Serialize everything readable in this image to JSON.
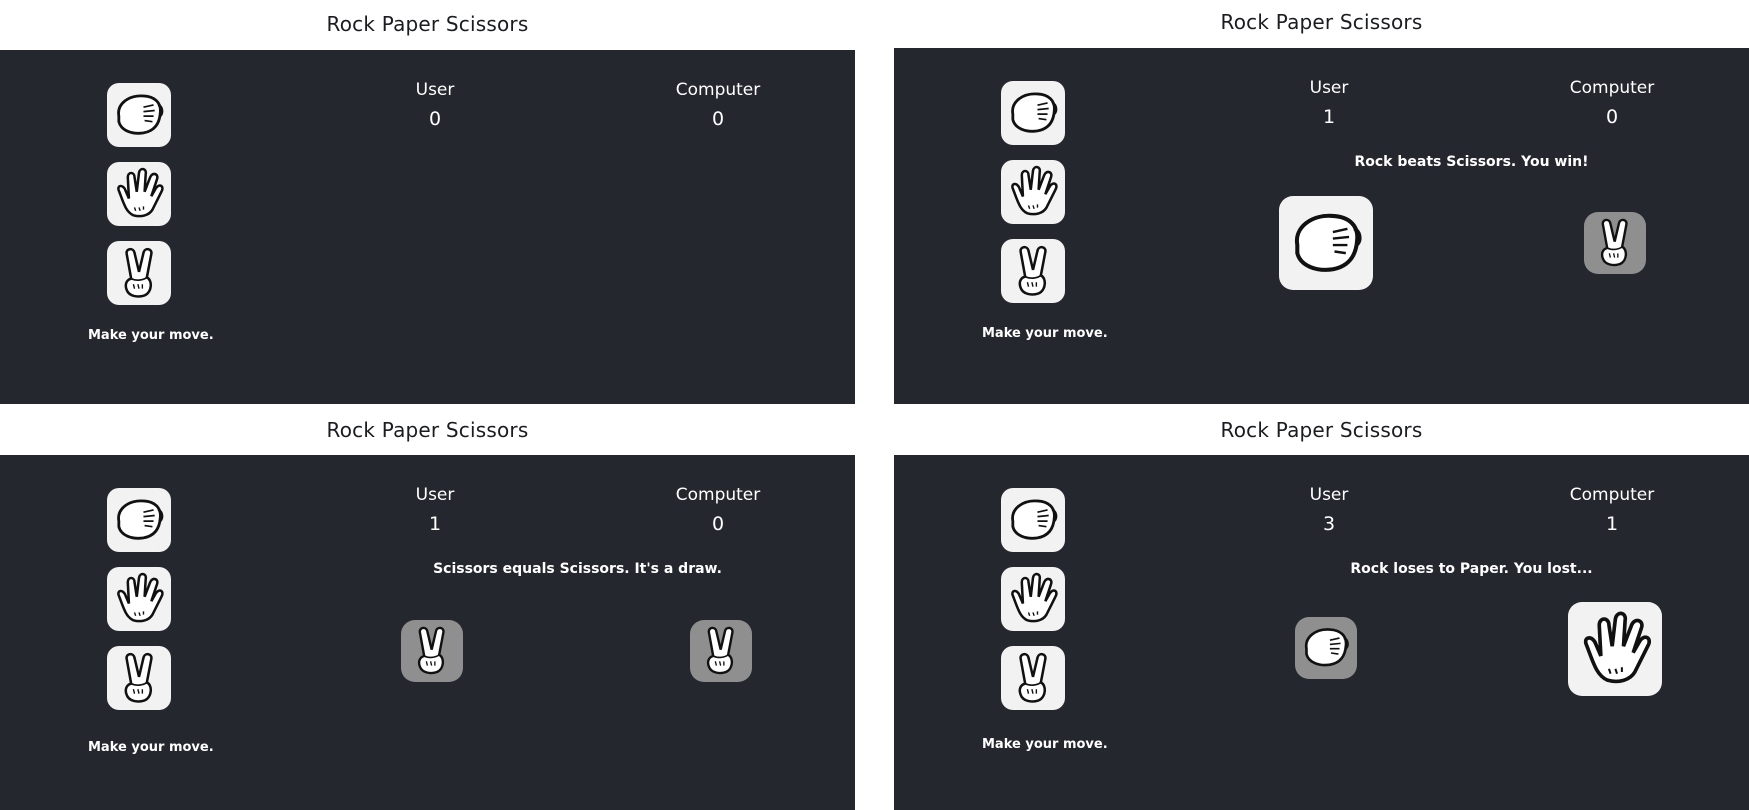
{
  "panels": [
    {
      "title": "Rock Paper Scissors",
      "score_labels": {
        "user": "User",
        "computer": "Computer"
      },
      "scores": {
        "user": "0",
        "computer": "0"
      },
      "result": "",
      "prompt": "Make your move.",
      "choices": [
        "rock-icon",
        "paper-icon",
        "scissors-icon"
      ]
    },
    {
      "title": "Rock Paper Scissors",
      "score_labels": {
        "user": "User",
        "computer": "Computer"
      },
      "scores": {
        "user": "1",
        "computer": "0"
      },
      "result": "Rock beats Scissors. You win!",
      "prompt": "Make your move.",
      "user_pick": "rock-icon",
      "computer_pick": "scissors-icon"
    },
    {
      "title": "Rock Paper Scissors",
      "score_labels": {
        "user": "User",
        "computer": "Computer"
      },
      "scores": {
        "user": "1",
        "computer": "0"
      },
      "result": "Scissors equals Scissors. It's a draw.",
      "prompt": "Make your move.",
      "user_pick": "scissors-icon",
      "computer_pick": "scissors-icon"
    },
    {
      "title": "Rock Paper Scissors",
      "score_labels": {
        "user": "User",
        "computer": "Computer"
      },
      "scores": {
        "user": "3",
        "computer": "1"
      },
      "result": "Rock loses to Paper. You lost...",
      "prompt": "Make your move.",
      "user_pick": "rock-icon",
      "computer_pick": "paper-icon"
    }
  ],
  "colors": {
    "board": "#24272e",
    "tile": "#f2f2f2",
    "tile_dim": "#8f8f8f",
    "header": "#ffffff"
  }
}
